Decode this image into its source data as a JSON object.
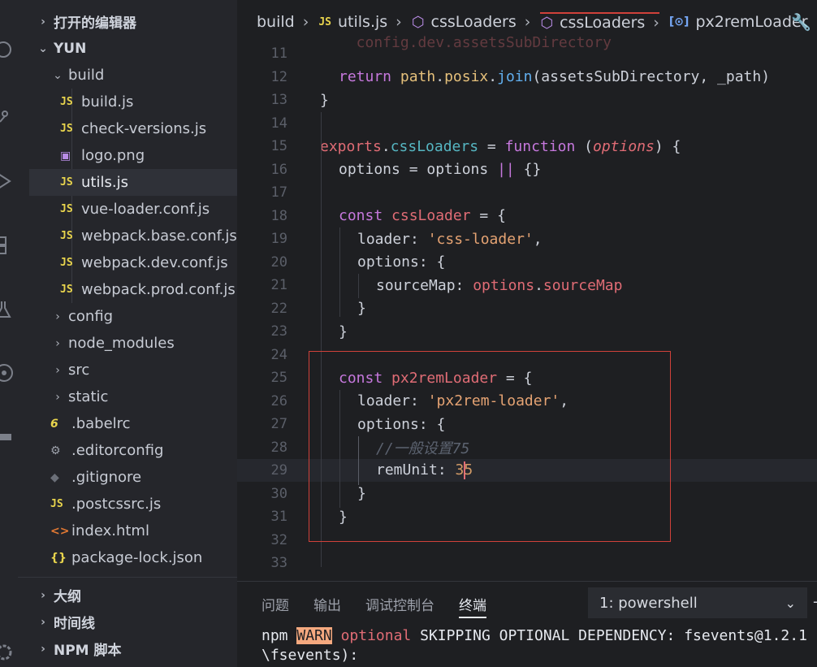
{
  "sidebar": {
    "open_editors_label": "打开的编辑器",
    "workspace_label": "YUN",
    "items": [
      {
        "name": "build",
        "type": "folder"
      },
      {
        "name": "build.js",
        "type": "js"
      },
      {
        "name": "check-versions.js",
        "type": "js"
      },
      {
        "name": "logo.png",
        "type": "image"
      },
      {
        "name": "utils.js",
        "type": "js"
      },
      {
        "name": "vue-loader.conf.js",
        "type": "js"
      },
      {
        "name": "webpack.base.conf.js",
        "type": "js"
      },
      {
        "name": "webpack.dev.conf.js",
        "type": "js"
      },
      {
        "name": "webpack.prod.conf.js",
        "type": "js"
      },
      {
        "name": "config",
        "type": "folder"
      },
      {
        "name": "node_modules",
        "type": "folder"
      },
      {
        "name": "src",
        "type": "folder"
      },
      {
        "name": "static",
        "type": "folder"
      },
      {
        "name": ".babelrc",
        "type": "babel"
      },
      {
        "name": ".editorconfig",
        "type": "gear"
      },
      {
        "name": ".gitignore",
        "type": "git"
      },
      {
        "name": ".postcssrc.js",
        "type": "js"
      },
      {
        "name": "index.html",
        "type": "html"
      },
      {
        "name": "package-lock.json",
        "type": "json"
      }
    ],
    "outline_label": "大纲",
    "timeline_label": "时间线",
    "npm_label": "NPM 脚本"
  },
  "breadcrumbs": [
    "build",
    "utils.js",
    "cssLoaders",
    "cssLoaders",
    "px2remLoader"
  ],
  "code": {
    "line_numbers": [
      "11",
      "12",
      "13",
      "14",
      "15",
      "16",
      "17",
      "18",
      "19",
      "20",
      "21",
      "22",
      "23",
      "24",
      "25",
      "26",
      "27",
      "28",
      "29",
      "30",
      "31",
      "32",
      "33"
    ],
    "partial_top": "  config.dev.assetsSubDirectory",
    "l12_return": "return",
    "l12_path": "path",
    "l12_posix": "posix",
    "l12_join": "join",
    "l12_args": "(assetsSubDirectory, _path)",
    "l13": "}",
    "l15_exports": "exports",
    "l15_css": "cssLoaders",
    "l15_fn": "function",
    "l15_opt": "options",
    "l16_a": "options = options",
    "l16_op": "||",
    "l16_b": "{}",
    "l18_const": "const",
    "l18_name": "cssLoader",
    "l18_rest": " = {",
    "l19_key": "loader: ",
    "l19_val": "'css-loader'",
    "l20": "options: {",
    "l21_key": "sourceMap: ",
    "l21_obj": "options",
    "l21_prop": "sourceMap",
    "l22": "}",
    "l23": "}",
    "l25_const": "const",
    "l25_name": "px2remLoader",
    "l25_rest": " = {",
    "l26_key": "loader: ",
    "l26_val": "'px2rem-loader'",
    "l27": "options: {",
    "l28_cmt": "//一般设置75",
    "l29_key": "remUnit: ",
    "l29_val_a": "3",
    "l29_val_b": "5",
    "l30": "}",
    "l31": "}"
  },
  "panel": {
    "tabs": [
      "问题",
      "输出",
      "调试控制台",
      "终端"
    ],
    "active_tab": "终端",
    "terminal_select": "1: powershell",
    "terminal_line1_npm": "npm ",
    "terminal_line1_warn": "WARN",
    "terminal_line1_opt": "optional",
    "terminal_line1_rest": " SKIPPING OPTIONAL DEPENDENCY: fsevents@1.2.1",
    "terminal_line2": "\\fsevents):"
  },
  "colors": {
    "background": "#1e1f22",
    "sidebar": "#25262b",
    "highlight_box": "#d0413a",
    "keyword": "#c678dd",
    "string": "#e5a373"
  }
}
